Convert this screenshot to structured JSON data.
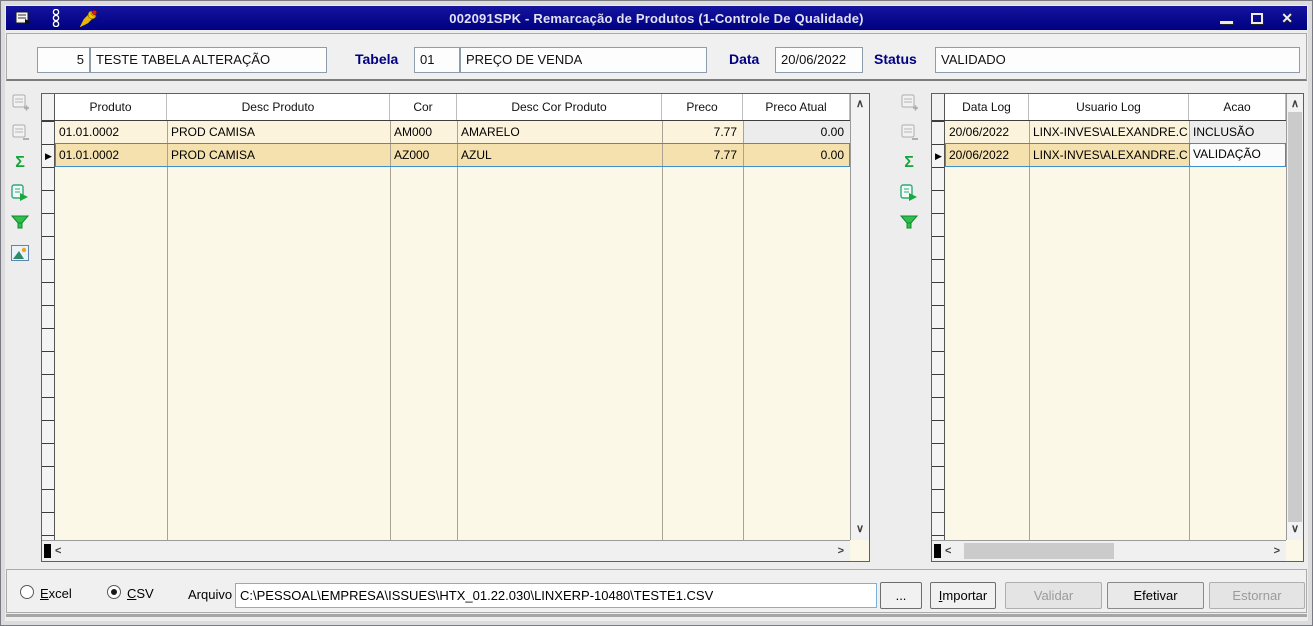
{
  "window": {
    "title": "002091SPK - Remarcação de Produtos (1-Controle De Qualidade)",
    "close_glyph": "✕"
  },
  "icons": {
    "sigma": "Σ",
    "row_pointer": "▶",
    "scroll_up": "∧",
    "scroll_down": "∨",
    "scroll_left": "<",
    "scroll_right": ">"
  },
  "header": {
    "code": "5",
    "description": "TESTE TABELA ALTERAÇÃO",
    "tabela_label": "Tabela",
    "tabela_code": "01",
    "tabela_desc": "PREÇO DE VENDA",
    "data_label": "Data",
    "data_value": "20/06/2022",
    "status_label": "Status",
    "status_value": "VALIDADO"
  },
  "left_grid": {
    "columns": [
      "Produto",
      "Desc Produto",
      "Cor",
      "Desc Cor Produto",
      "Preco",
      "Preco Atual"
    ],
    "rows": [
      {
        "produto": "01.01.0002",
        "desc_produto": "PROD CAMISA",
        "cor": "AM000",
        "desc_cor": "AMARELO",
        "preco": "7.77",
        "preco_atual": "0.00"
      },
      {
        "produto": "01.01.0002",
        "desc_produto": "PROD CAMISA",
        "cor": "AZ000",
        "desc_cor": "AZUL",
        "preco": "7.77",
        "preco_atual": "0.00"
      }
    ]
  },
  "right_grid": {
    "columns": [
      "Data Log",
      "Usuario Log",
      "Acao"
    ],
    "rows": [
      {
        "data_log": "20/06/2022",
        "usuario_log": "LINX-INVES\\ALEXANDRE.C",
        "acao": "INCLUSÃO"
      },
      {
        "data_log": "20/06/2022",
        "usuario_log": "LINX-INVES\\ALEXANDRE.C",
        "acao": "VALIDAÇÃO"
      }
    ]
  },
  "footer": {
    "excel_accel": "E",
    "excel_rest": "xcel",
    "csv_accel": "C",
    "csv_rest": "SV",
    "arquivo_label": "Arquivo",
    "file_path": "C:\\PESSOAL\\EMPRESA\\ISSUES\\HTX_01.22.030\\LINXERP-10480\\TESTE1.CSV",
    "browse_label": "...",
    "importar_accel": "I",
    "importar_rest": "mportar",
    "validar_label": "Validar",
    "efetivar_label": "Efetivar",
    "estornar_label": "Estornar"
  },
  "colors": {
    "titlebar": "#000082",
    "grid_bg": "#FCF8E8",
    "row_bg": "#FBF3DC",
    "row_selected_bg": "#F5E1AE",
    "selection_border": "#3E8FD0",
    "label_navy": "#000080"
  }
}
